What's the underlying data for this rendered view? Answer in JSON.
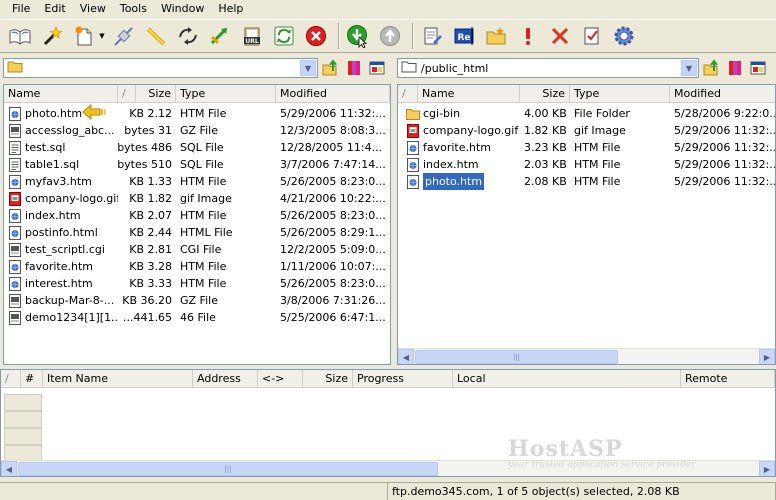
{
  "menu": [
    "File",
    "Edit",
    "View",
    "Tools",
    "Window",
    "Help"
  ],
  "local": {
    "path": "",
    "columns": [
      "Name",
      "/",
      "Size",
      "Type",
      "Modified"
    ],
    "files": [
      {
        "name": "photo.htm",
        "size": "2.12 KB",
        "type": "HTM File",
        "modified": "5/29/2006 11:32:...",
        "icon": "htm"
      },
      {
        "name": "accesslog_abc...",
        "size": "31 bytes",
        "type": "GZ File",
        "modified": "12/3/2005 8:08:3...",
        "icon": "gz"
      },
      {
        "name": "test.sql",
        "size": "486 bytes",
        "type": "SQL File",
        "modified": "12/28/2005 11:4...",
        "icon": "sql"
      },
      {
        "name": "table1.sql",
        "size": "510 bytes",
        "type": "SQL File",
        "modified": "3/7/2006 7:47:14...",
        "icon": "sql"
      },
      {
        "name": "myfav3.htm",
        "size": "1.33 KB",
        "type": "HTM File",
        "modified": "5/26/2005 8:23:0...",
        "icon": "htm"
      },
      {
        "name": "company-logo.gif",
        "size": "1.82 KB",
        "type": "gif Image",
        "modified": "4/21/2006 10:22:...",
        "icon": "gif"
      },
      {
        "name": "index.htm",
        "size": "2.07 KB",
        "type": "HTM File",
        "modified": "5/26/2005 8:23:0...",
        "icon": "htm"
      },
      {
        "name": "postinfo.html",
        "size": "2.44 KB",
        "type": "HTML File",
        "modified": "5/26/2005 8:29:1...",
        "icon": "htm"
      },
      {
        "name": "test_scriptl.cgi",
        "size": "2.81 KB",
        "type": "CGI File",
        "modified": "12/2/2005 5:09:0...",
        "icon": "gz"
      },
      {
        "name": "favorite.htm",
        "size": "3.28 KB",
        "type": "HTM File",
        "modified": "1/11/2006 10:07:...",
        "icon": "htm"
      },
      {
        "name": "interest.htm",
        "size": "3.33 KB",
        "type": "HTM File",
        "modified": "5/26/2005 8:23:0...",
        "icon": "htm"
      },
      {
        "name": "backup-Mar-8-...",
        "size": "36.20 KB",
        "type": "GZ File",
        "modified": "3/8/2006 7:31:26...",
        "icon": "gz"
      },
      {
        "name": "demo1234[1][1...",
        "size": "441.65...",
        "type": "46 File",
        "modified": "5/25/2006 6:47:1...",
        "icon": "gz"
      }
    ]
  },
  "remote": {
    "path": "/public_html",
    "columns": [
      "/",
      "Name",
      "Size",
      "Type",
      "Modified"
    ],
    "files": [
      {
        "name": "cgi-bin",
        "size": "4.00 KB",
        "type": "File Folder",
        "modified": "5/28/2006 9:22:0...",
        "icon": "folder"
      },
      {
        "name": "company-logo.gif",
        "size": "1.82 KB",
        "type": "gif Image",
        "modified": "5/29/2006 11:32:...",
        "icon": "gif"
      },
      {
        "name": "favorite.htm",
        "size": "3.23 KB",
        "type": "HTM File",
        "modified": "5/29/2006 11:32:...",
        "icon": "htm"
      },
      {
        "name": "index.htm",
        "size": "2.03 KB",
        "type": "HTM File",
        "modified": "5/29/2006 11:32:...",
        "icon": "htm"
      },
      {
        "name": "photo.htm",
        "size": "2.08 KB",
        "type": "HTM File",
        "modified": "5/29/2006 11:32:...",
        "icon": "htm",
        "selected": true
      }
    ]
  },
  "queue": {
    "columns": [
      "/",
      "#",
      "Item Name",
      "Address",
      "<->",
      "Size",
      "Progress",
      "Local",
      "Remote"
    ]
  },
  "watermark": {
    "brand": "HostASP",
    "tagline": "your trusted application service provider"
  },
  "status": {
    "text": "ftp.demo345.com, 1 of 5 object(s) selected, 2.08 KB"
  },
  "colors": {
    "selection": "#316ac5",
    "border": "#7f9db9",
    "chrome": "#ece9d8"
  }
}
